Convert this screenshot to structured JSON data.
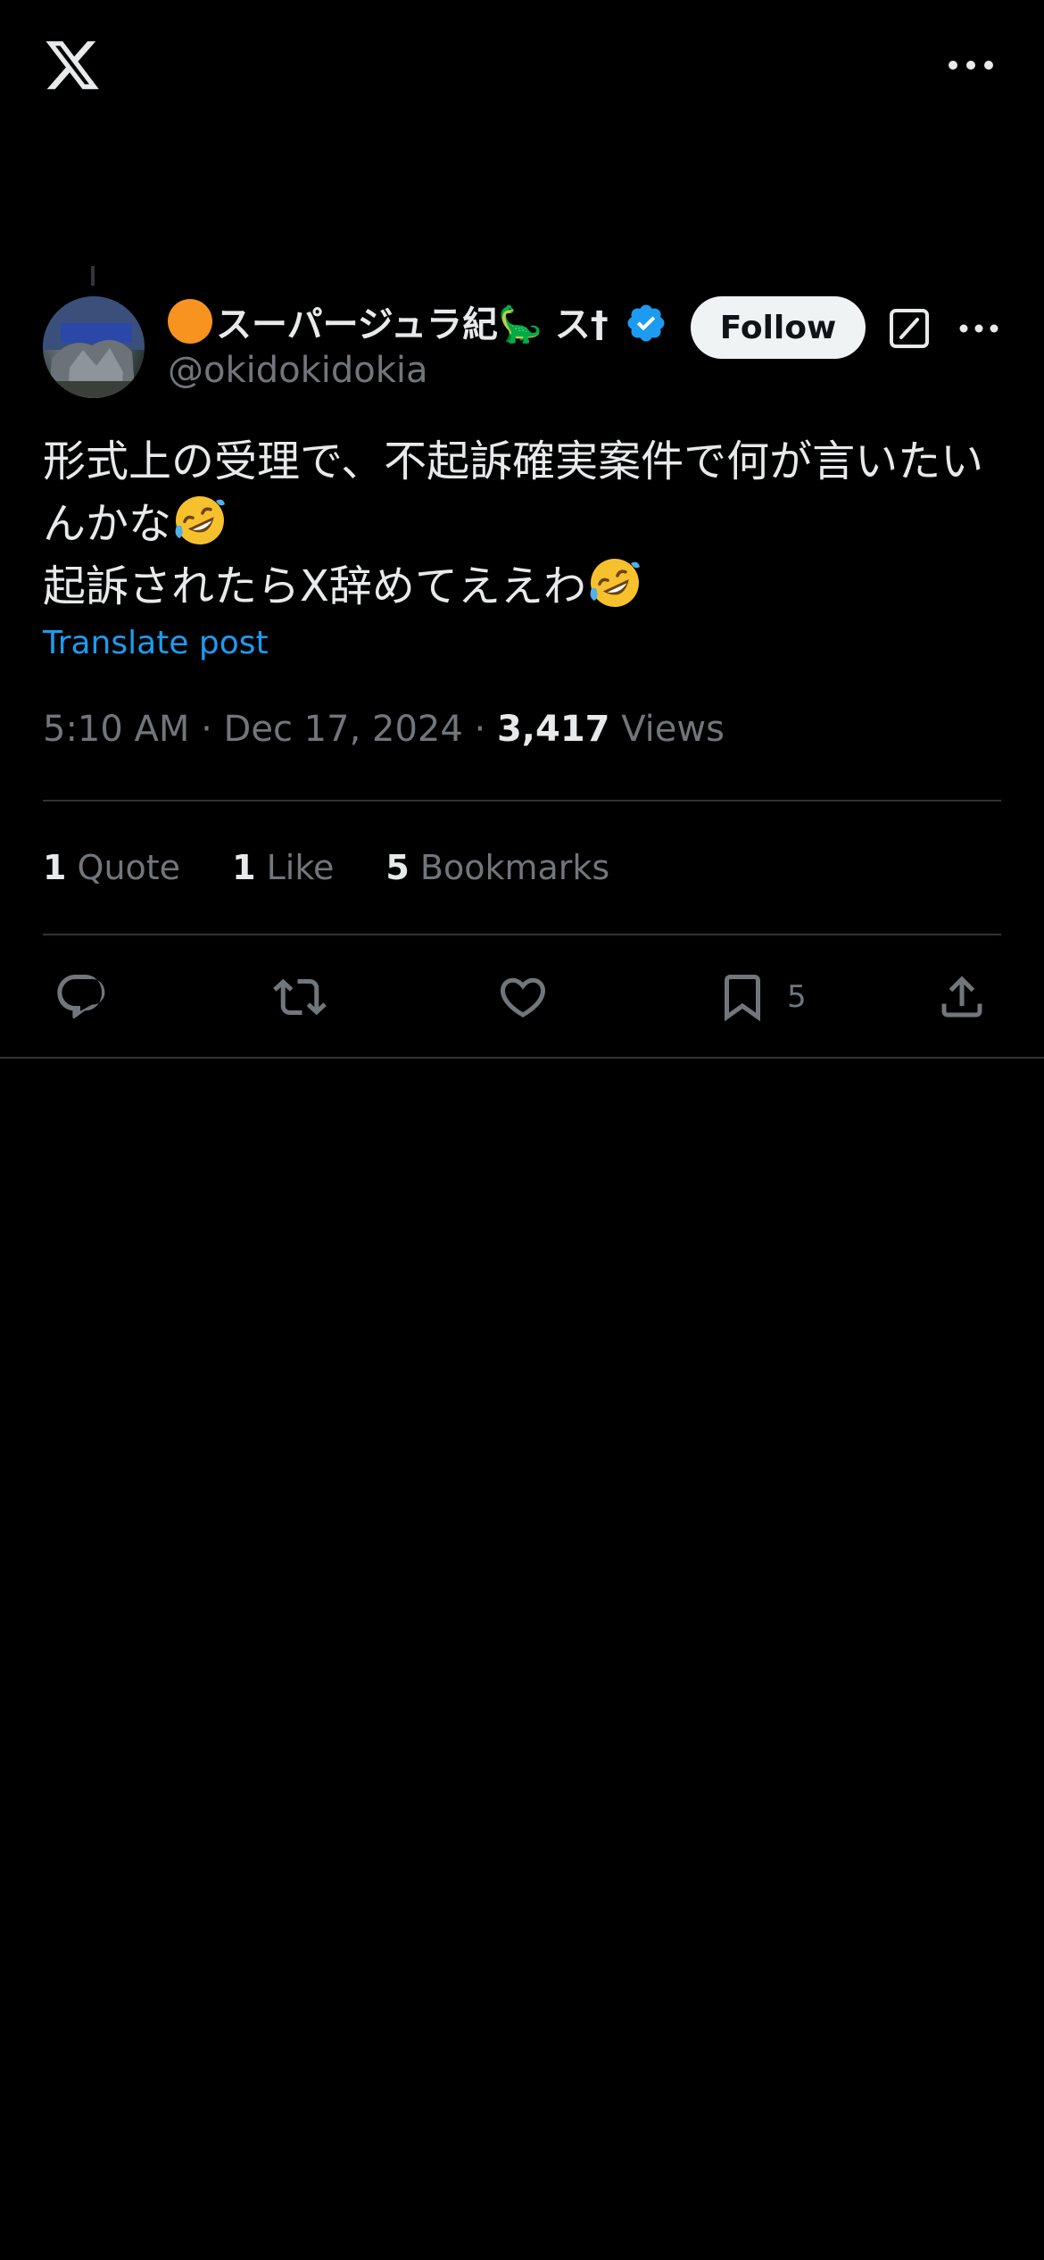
{
  "header": {
    "logo_icon": "x-logo-icon",
    "more_icon": "more-horizontal-icon"
  },
  "post": {
    "author": {
      "display_name": "スーパージュラ紀🦕 ス†",
      "handle": "@okidokidokia",
      "verified": true,
      "follow_label": "Follow"
    },
    "text_lines": [
      "形式上の受理で、不起訴確実案件で何が言いたい",
      "んかな",
      "起訴されたらX辞めてええわ"
    ],
    "translate_label": "Translate post",
    "timestamp": "5:10 AM · Dec 17, 2024 · ",
    "views_count": "3,417",
    "views_label": " Views"
  },
  "stats": [
    {
      "count": "1",
      "label": " Quote"
    },
    {
      "count": "1",
      "label": " Like"
    },
    {
      "count": "5",
      "label": " Bookmarks"
    }
  ],
  "actions": {
    "bookmark_count": "5"
  },
  "colors": {
    "background": "#000000",
    "text": "#e7e9ea",
    "muted": "#71767b",
    "link": "#1d9bf0",
    "divider": "#2f3336",
    "verified": "#1d9bf0"
  }
}
